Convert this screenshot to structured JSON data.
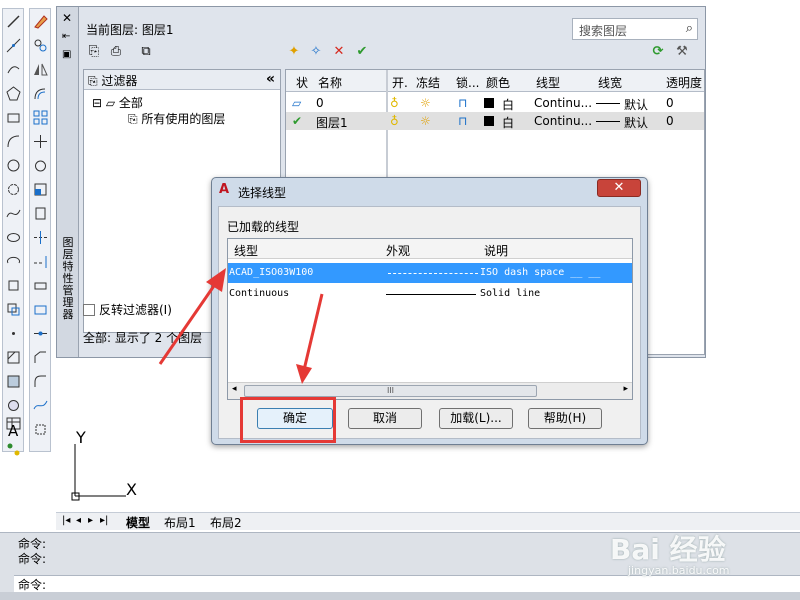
{
  "layer_manager": {
    "side_title": "图层特性管理器",
    "current_layer_label": "当前图层: 图层1",
    "search_placeholder": "搜索图层",
    "filter_header": "过滤器",
    "filter_all": "全部",
    "filter_used": "所有使用的图层",
    "invert_filter": "反转过滤器(I)",
    "status_text": "全部: 显示了 2 个图层",
    "columns": [
      "状",
      "名称",
      "开.",
      "冻结",
      "锁...",
      "颜色",
      "线型",
      "线宽",
      "透明度"
    ],
    "rows": [
      {
        "name": "0",
        "color_name": "白",
        "linetype": "Continu...",
        "lineweight": "默认",
        "transparency": "0"
      },
      {
        "name": "图层1",
        "color_name": "白",
        "linetype": "Continu...",
        "lineweight": "默认",
        "transparency": "0"
      }
    ]
  },
  "dialog": {
    "logo": "A",
    "title": "选择线型",
    "close": "✕",
    "loaded_label": "已加载的线型",
    "columns": [
      "线型",
      "外观",
      "说明"
    ],
    "rows": [
      {
        "linetype": "ACAD_ISO03W100",
        "description": "ISO dash space __    __"
      },
      {
        "linetype": "Continuous",
        "description": "Solid line"
      }
    ],
    "scroll_grip": "III",
    "ok": "确定",
    "cancel": "取消",
    "load": "加载(L)...",
    "help": "帮助(H)"
  },
  "ucs": {
    "y": "Y",
    "x": "X"
  },
  "tabs": [
    "模型",
    "布局1",
    "布局2"
  ],
  "command": {
    "history": [
      "命令:",
      "命令:"
    ],
    "prompt": "命令:"
  },
  "watermark": {
    "brand": "Bai 经验",
    "url": "jingyan.baidu.com"
  },
  "colors": {
    "accent_red": "#e53935",
    "selection": "#3399ff",
    "panel": "#dfe4ec"
  }
}
